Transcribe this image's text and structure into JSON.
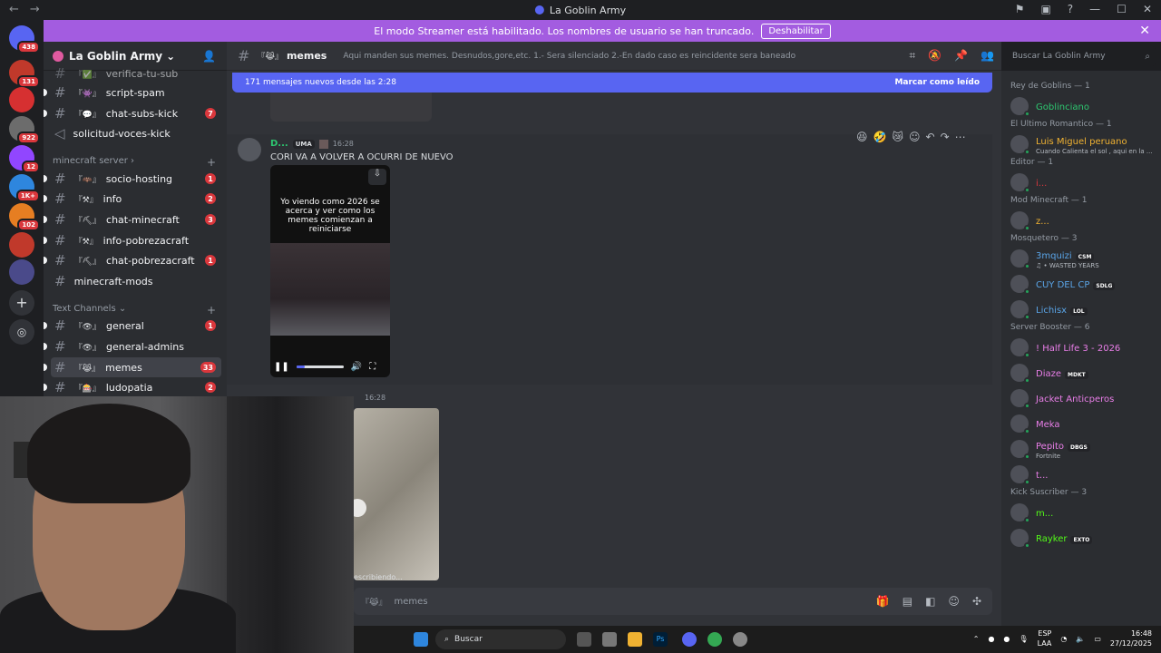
{
  "window": {
    "title": "La Goblin Army"
  },
  "banner": {
    "text": "El modo Streamer está habilitado. Los nombres de usuario se han truncado.",
    "button": "Deshabilitar"
  },
  "guild_badges": [
    "438",
    "131",
    "922",
    "12",
    "1K+",
    "102"
  ],
  "server": {
    "name": "La Goblin Army"
  },
  "channels": [
    {
      "emoji": "『✅』",
      "name": "verifica-tu-sub",
      "count": ""
    },
    {
      "emoji": "『👾』",
      "name": "script-spam",
      "count": ""
    },
    {
      "emoji": "『💬』",
      "name": "chat-subs-kick",
      "count": "7"
    },
    {
      "emoji": "",
      "name": "solicitud-voces-kick",
      "count": ""
    },
    {
      "emoji": "『🦇』",
      "name": "socio-hosting",
      "count": "1"
    },
    {
      "emoji": "『⚒』",
      "name": "info",
      "count": "2"
    },
    {
      "emoji": "『⛏』",
      "name": "chat-minecraft",
      "count": "3"
    },
    {
      "emoji": "『⚒』",
      "name": "info-pobrezacraft",
      "count": ""
    },
    {
      "emoji": "『⛏』",
      "name": "chat-pobrezacraft",
      "count": "1"
    },
    {
      "emoji": "",
      "name": "minecraft-mods",
      "count": ""
    },
    {
      "emoji": "『👁』",
      "name": "general",
      "count": "1"
    },
    {
      "emoji": "『👁』",
      "name": "general-admins",
      "count": ""
    },
    {
      "emoji": "『😹』",
      "name": "memes",
      "count": "33"
    },
    {
      "emoji": "『🎰』",
      "name": "ludopatia",
      "count": "2"
    }
  ],
  "categories": {
    "minecraft": "minecraft server",
    "text": "Text Channels"
  },
  "chat": {
    "channel_emoji": "『😹』",
    "channel": "memes",
    "topic": "Aqui manden sus memes. Desnudos,gore,etc. 1.- Sera silenciado 2.-En dado caso es reincidente sera baneado",
    "search_placeholder": "Buscar La Goblin Army",
    "new_messages": "171 mensajes nuevos desde las 2:28",
    "mark_read": "Marcar como leído",
    "message": {
      "author": "D...",
      "tag": "UMA",
      "time": "16:28",
      "text": "CORI VA A VOLVER A OCURRI DE NUEVO",
      "video_caption": "Yo viendo como 2026 se acerca y ver como los memes comienzan a reiniciarse",
      "video_progress": 0.18
    },
    "message2_time": "16:28",
    "typing": "escribiendo...",
    "input_emoji": "『😹』",
    "input_placeholder": "memes"
  },
  "members": [
    {
      "category": "Rey de Goblins — 1"
    },
    {
      "name": "Goblinciano",
      "color": "#2dc770",
      "sub": "",
      "tag": ""
    },
    {
      "category": "El Ultimo Romantico — 1"
    },
    {
      "name": "Luis Miguel peruano",
      "color": "#f0b232",
      "sub": "Cuando Calienta el sol , aqui en la ...",
      "tag": ""
    },
    {
      "category": "Editor — 1"
    },
    {
      "name": "i...",
      "color": "#da373c",
      "sub": "",
      "tag": ""
    },
    {
      "category": "Mod Minecraft — 1"
    },
    {
      "name": "z...",
      "color": "#f0b232",
      "sub": "",
      "tag": ""
    },
    {
      "category": "Mosquetero — 3"
    },
    {
      "name": "3mquizi",
      "color": "#5aa5e8",
      "sub": "♫ • WASTED YEARS",
      "tag": "CSM"
    },
    {
      "name": "CUY DEL CP",
      "color": "#5aa5e8",
      "sub": "",
      "tag": "SDLG"
    },
    {
      "name": "Lichisx",
      "color": "#5aa5e8",
      "sub": "",
      "tag": "LOL"
    },
    {
      "category": "Server Booster — 6"
    },
    {
      "name": "! Half Life 3 - 2026",
      "color": "#e97ee8",
      "sub": "",
      "tag": ""
    },
    {
      "name": "Diaze",
      "color": "#e97ee8",
      "sub": "",
      "tag": "MDKT"
    },
    {
      "name": "Jacket Anticperos",
      "color": "#e97ee8",
      "sub": "",
      "tag": ""
    },
    {
      "name": "Meka",
      "color": "#e97ee8",
      "sub": "",
      "tag": ""
    },
    {
      "name": "Pepito",
      "color": "#e97ee8",
      "sub": "Fortnite",
      "tag": "DBGS"
    },
    {
      "name": "t...",
      "color": "#e97ee8",
      "sub": "",
      "tag": ""
    },
    {
      "category": "Kick Suscriber — 3"
    },
    {
      "name": "m...",
      "color": "#53fc18",
      "sub": "",
      "tag": ""
    },
    {
      "name": "Rayker",
      "color": "#53fc18",
      "sub": "",
      "tag": "EXTO"
    }
  ],
  "taskbar": {
    "search": "Buscar",
    "lang": "ESP",
    "lang2": "LAA",
    "time": "16:48",
    "date": "27/12/2025"
  }
}
